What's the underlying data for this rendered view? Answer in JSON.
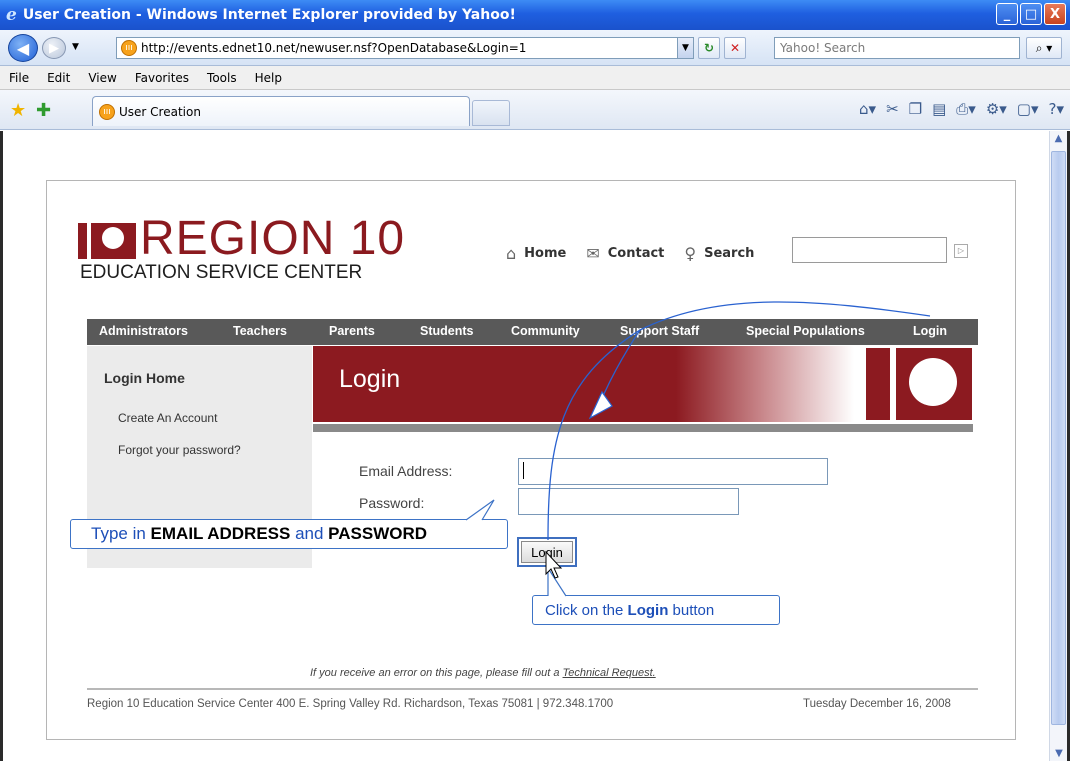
{
  "window": {
    "title": "User Creation - Windows Internet Explorer provided by Yahoo!",
    "buttons": [
      "_",
      "□",
      "X"
    ]
  },
  "browser": {
    "url": "http://events.ednet10.net/newuser.nsf?OpenDatabase&Login=1",
    "search_placeholder": "Yahoo! Search",
    "menu": [
      "File",
      "Edit",
      "View",
      "Favorites",
      "Tools",
      "Help"
    ],
    "tab_title": "User Creation"
  },
  "site": {
    "logo_main": "REGION 10",
    "logo_sub": "EDUCATION SERVICE CENTER",
    "util_links": [
      "Home",
      "Contact",
      "Search"
    ],
    "nav": [
      "Administrators",
      "Teachers",
      "Parents",
      "Students",
      "Community",
      "Support Staff",
      "Special Populations",
      "Login"
    ],
    "sidebar": {
      "title": "Login Home",
      "links": [
        "Create An Account",
        "Forgot your password?"
      ]
    },
    "banner_title": "Login",
    "form": {
      "email_label": "Email Address:",
      "password_label": "Password:",
      "login_button": "Login"
    },
    "footer_note_prefix": "If you receive an error on this page, please fill out a ",
    "footer_note_link": "Technical Request.",
    "footer_address": "Region 10 Education Service Center 400 E. Spring Valley Rd. Richardson, Texas 75081 | 972.348.1700",
    "footer_date": "Tuesday December 16, 2008"
  },
  "annotations": {
    "callout1_pre": "Type in ",
    "callout1_b1": "EMAIL ADDRESS",
    "callout1_mid": " and ",
    "callout1_b2": "PASSWORD",
    "callout2_pre": "Click on the ",
    "callout2_b": "Login",
    "callout2_post": " button"
  },
  "colors": {
    "brand_red": "#8c1a20",
    "nav_gray": "#595959",
    "callout_blue": "#3d73c6"
  }
}
